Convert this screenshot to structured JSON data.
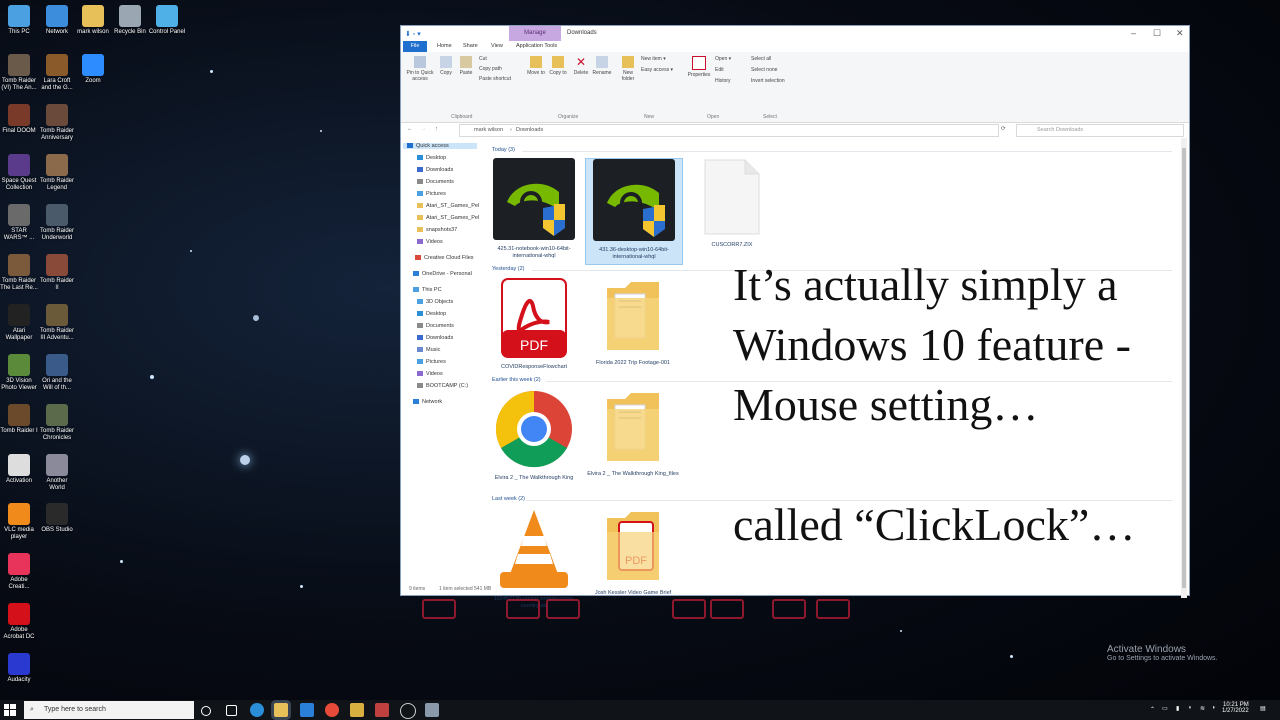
{
  "desktop": {
    "icons": [
      {
        "label": "This PC",
        "color": "#4aa0e0"
      },
      {
        "label": "Network",
        "color": "#3c8ddc"
      },
      {
        "label": "mark wilson",
        "color": "#e8c05a"
      },
      {
        "label": "Recycle Bin",
        "color": "#9aa6b2"
      },
      {
        "label": "Control Panel",
        "color": "#4fb0e8"
      },
      {
        "label": "Tomb Raider (VI) The An...",
        "color": "#6a5a4a"
      },
      {
        "label": "Lara Croft and the G...",
        "color": "#8a5a2a"
      },
      {
        "label": "Zoom",
        "color": "#2d8cff"
      },
      {
        "label": "Final DOOM",
        "color": "#7a3a2a"
      },
      {
        "label": "Tomb Raider Anniversary",
        "color": "#6a4a3a"
      },
      {
        "label": "Space Quest Collection",
        "color": "#5a3a8a"
      },
      {
        "label": "Tomb Raider Legend",
        "color": "#8a6a4a"
      },
      {
        "label": "STAR WARS™ ...",
        "color": "#6a6a6a"
      },
      {
        "label": "Tomb Raider Underworld",
        "color": "#4a5a6a"
      },
      {
        "label": "Tomb Raider The Last Re...",
        "color": "#7a5a3a"
      },
      {
        "label": "Tomb Raider II",
        "color": "#8a4a3a"
      },
      {
        "label": "Atari Wallpaper",
        "color": "#222222"
      },
      {
        "label": "Tomb Raider III Adventu...",
        "color": "#6a5a3a"
      },
      {
        "label": "3D Vision Photo Viewer",
        "color": "#5a8a3a"
      },
      {
        "label": "Ori and the Will of th...",
        "color": "#3a5a8a"
      },
      {
        "label": "Tomb Raider I",
        "color": "#6a4a2a"
      },
      {
        "label": "Tomb Raider Chronicles",
        "color": "#5a6a4a"
      },
      {
        "label": "Activation",
        "color": "#dddddd"
      },
      {
        "label": "Another World",
        "color": "#8a8a9a"
      },
      {
        "label": "VLC media player",
        "color": "#f08a1a"
      },
      {
        "label": "OBS Studio",
        "color": "#2a2a2a"
      },
      {
        "label": "Adobe Creati...",
        "color": "#e8345a"
      },
      {
        "label": "Adobe Acrobat DC",
        "color": "#d4101a"
      },
      {
        "label": "Audacity",
        "color": "#2a3ad0"
      }
    ]
  },
  "window": {
    "title": "Downloads",
    "manage_tab": "Manage",
    "tabs": [
      "File",
      "Home",
      "Share",
      "View",
      "Application Tools"
    ],
    "ribbon": {
      "buttons": [
        "Pin to Quick access",
        "Copy",
        "Paste",
        "Cut",
        "Copy path",
        "Paste shortcut",
        "Move to",
        "Copy to",
        "Delete",
        "Rename",
        "New folder",
        "New item",
        "Easy access",
        "Properties",
        "Open",
        "Edit",
        "History",
        "Select all",
        "Select none",
        "Invert selection"
      ],
      "groups": [
        "Clipboard",
        "Organize",
        "New",
        "Open",
        "Select"
      ]
    },
    "address": [
      "mark wilson",
      "Downloads"
    ],
    "search_placeholder": "Search Downloads",
    "nav": [
      "Quick access",
      "Desktop",
      "Downloads",
      "Documents",
      "Pictures",
      "Atari_ST_Games_Pel",
      "Atari_ST_Games_Pel",
      "snapshots37",
      "Videos",
      "Creative Cloud Files",
      "OneDrive - Personal",
      "This PC",
      "3D Objects",
      "Desktop",
      "Documents",
      "Downloads",
      "Music",
      "Pictures",
      "Videos",
      "BOOTCAMP (C:)",
      "Network"
    ],
    "groups": [
      {
        "label": "Today (3)"
      },
      {
        "label": "Yesterday (2)"
      },
      {
        "label": "Earlier this week (2)"
      },
      {
        "label": "Last week (2)"
      }
    ],
    "files": [
      {
        "name": "425.31-notebook-win10-64bit-international-whql",
        "type": "nvidia"
      },
      {
        "name": "431.36-desktop-win10-64bit-international-whql",
        "type": "nvidia"
      },
      {
        "name": "CUSCORR7.ZIX",
        "type": "blank"
      },
      {
        "name": "COVIDResponseFlowchart",
        "type": "pdf"
      },
      {
        "name": "Florida 2022 Trip Footage-001",
        "type": "folder"
      },
      {
        "name": "Elvira 2 _ The Walkthrough King",
        "type": "chrome"
      },
      {
        "name": "Elvira 2 _ The Walkthrough King_files",
        "type": "folder"
      },
      {
        "name": "102457136-young-woman-cross-country-ski",
        "type": "vlc"
      },
      {
        "name": "Josh Kessler Video Game Brief",
        "type": "pdffolder"
      }
    ],
    "status": {
      "items": "9 items",
      "selected": "1 item selected  541 MB"
    }
  },
  "overlay": {
    "line1": "It’s actually simply a",
    "line2": "Windows 10 feature -",
    "line3": "Mouse setting…",
    "line4": "called “ClickLock”…"
  },
  "taskbar": {
    "search_placeholder": "Type here to search",
    "time": "10:21 PM",
    "date": "1/27/2022"
  },
  "watermark": {
    "title": "Activate Windows",
    "subtitle": "Go to Settings to activate Windows."
  }
}
